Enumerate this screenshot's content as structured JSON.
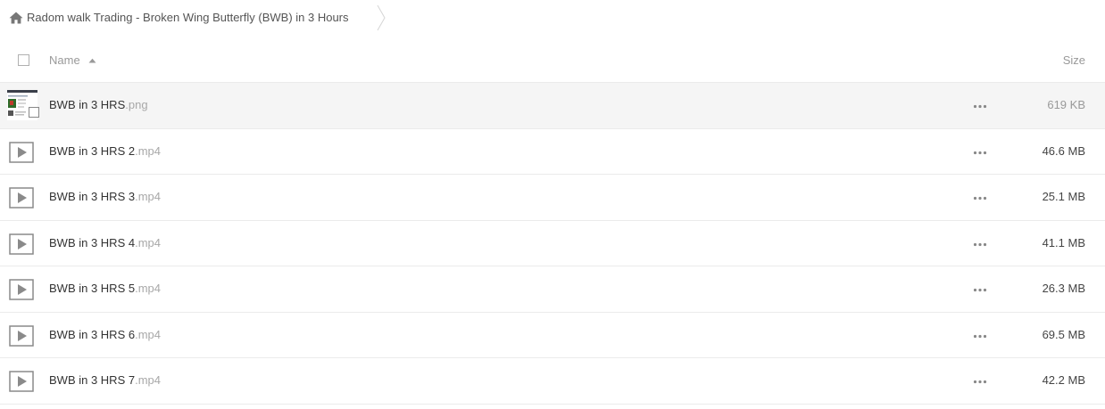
{
  "breadcrumb": {
    "folder_title": "Radom walk Trading - Broken Wing Butterfly (BWB) in 3 Hours",
    "icon": "home-icon"
  },
  "header": {
    "name_label": "Name",
    "size_label": "Size",
    "sort": "ascending"
  },
  "files": [
    {
      "name": "BWB in 3 HRS",
      "ext": ".png",
      "size": "619 KB",
      "type": "image",
      "highlighted": true
    },
    {
      "name": "BWB in 3 HRS 2",
      "ext": ".mp4",
      "size": "46.6 MB",
      "type": "video"
    },
    {
      "name": "BWB in 3 HRS 3",
      "ext": ".mp4",
      "size": "25.1 MB",
      "type": "video"
    },
    {
      "name": "BWB in 3 HRS 4",
      "ext": ".mp4",
      "size": "41.1 MB",
      "type": "video"
    },
    {
      "name": "BWB in 3 HRS 5",
      "ext": ".mp4",
      "size": "26.3 MB",
      "type": "video"
    },
    {
      "name": "BWB in 3 HRS 6",
      "ext": ".mp4",
      "size": "69.5 MB",
      "type": "video"
    },
    {
      "name": "BWB in 3 HRS 7",
      "ext": ".mp4",
      "size": "42.2 MB",
      "type": "video"
    }
  ],
  "colors": {
    "text": "#333333",
    "muted": "#999999",
    "divider": "#ebebeb",
    "highlight_row": "#f5f5f5"
  }
}
